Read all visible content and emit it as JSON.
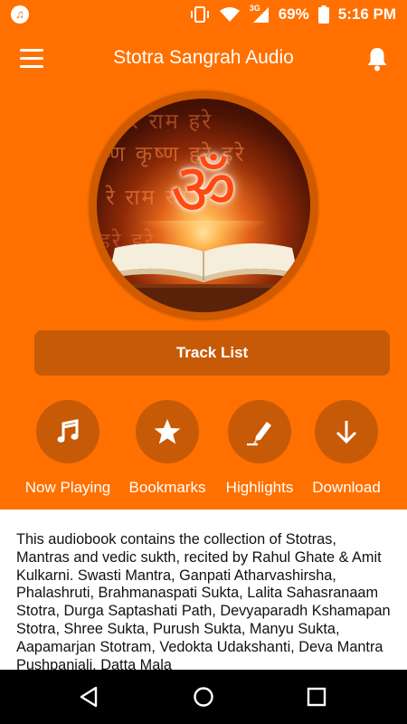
{
  "status_bar": {
    "battery_percent": "69%",
    "time": "5:16 PM",
    "network_label": "3G"
  },
  "app_bar": {
    "title": "Stotra Sangrah Audio"
  },
  "artwork": {
    "symbol": "ॐ",
    "script_lines": [
      "रे राम हरे",
      "ष्ण कृष्ण हरे हरे",
      "रे राम   राम",
      "हरे   हरे"
    ]
  },
  "track_list_button": {
    "label": "Track List"
  },
  "actions": [
    {
      "label": "Now Playing",
      "icon": "music-note-icon"
    },
    {
      "label": "Bookmarks",
      "icon": "star-icon"
    },
    {
      "label": "Highlights",
      "icon": "highlighter-icon"
    },
    {
      "label": "Download",
      "icon": "download-arrow-icon"
    }
  ],
  "description": "This audiobook contains the collection of Stotras, Mantras and vedic sukth, recited by Rahul Ghate & Amit Kulkarni. Swasti Mantra, Ganpati Atharvashirsha, Phalashruti, Brahmanaspati Sukta, Lalita Sahasranaam Stotra, Durga Saptashati Path, Devyaparadh Kshamapan Stotra, Shree Sukta, Purush Sukta, Manyu Sukta, Aapamarjan Stotram, Vedokta Udakshanti, Deva Mantra Pushpanjali, Datta Mala",
  "colors": {
    "primary": "#FF7000",
    "button": "#C75A07",
    "nav_bar": "#000000"
  }
}
